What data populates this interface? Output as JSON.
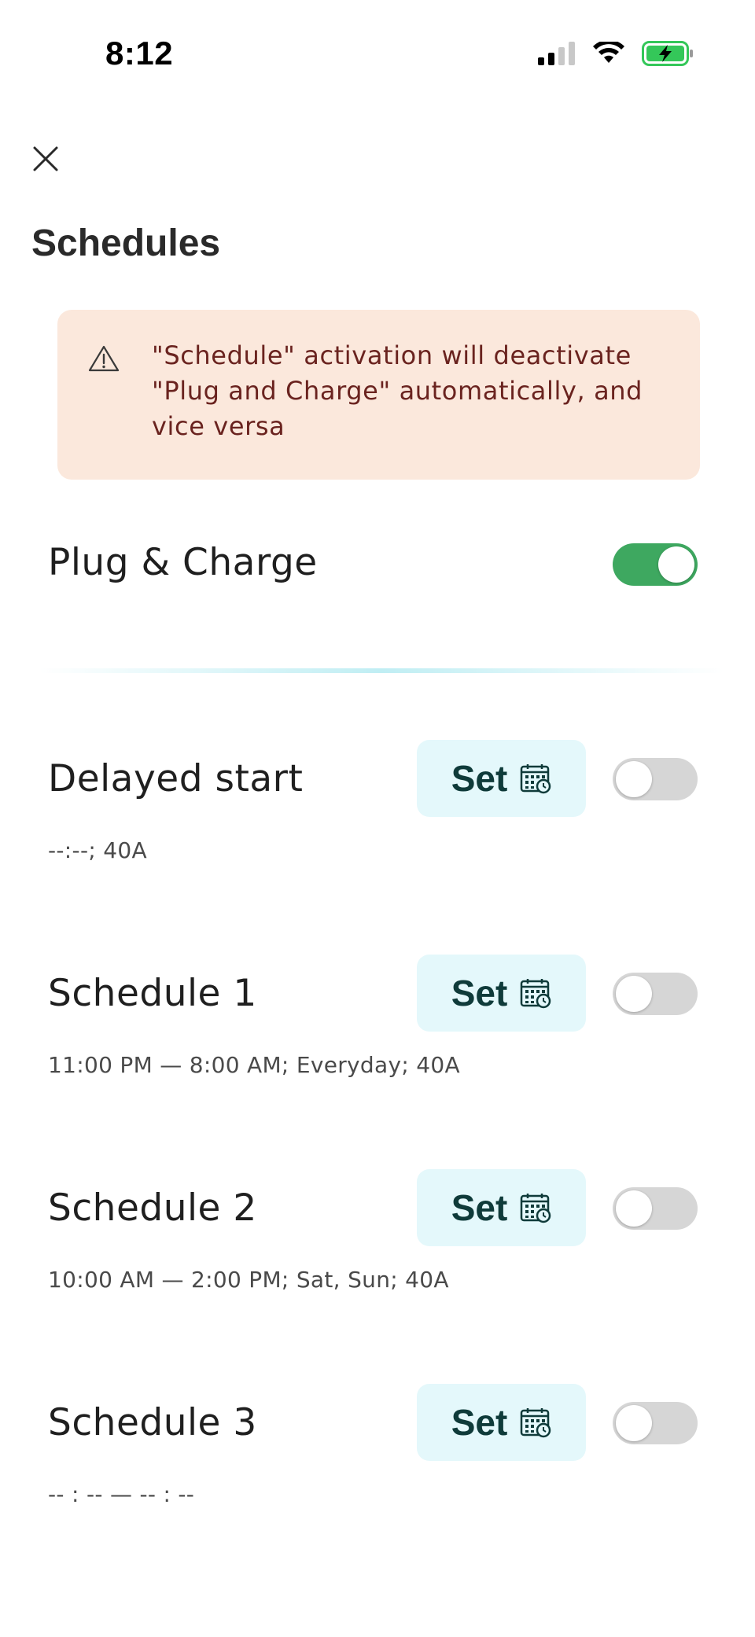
{
  "status_bar": {
    "time": "8:12"
  },
  "header": {
    "close_icon": "close-icon",
    "title": "Schedules"
  },
  "warning": {
    "icon": "warning-triangle-icon",
    "text": "\"Schedule\" activation will deactivate \"Plug and Charge\" automatically, and vice versa"
  },
  "plug_and_charge": {
    "label": "Plug & Charge",
    "enabled": true
  },
  "schedules": [
    {
      "title": "Delayed start",
      "details": "--:--; 40A",
      "button_label": "Set",
      "enabled": false
    },
    {
      "title": "Schedule 1",
      "details": "11:00 PM — 8:00 AM; Everyday; 40A",
      "button_label": "Set",
      "enabled": false
    },
    {
      "title": "Schedule 2",
      "details": "10:00 AM — 2:00 PM; Sat, Sun; 40A",
      "button_label": "Set",
      "enabled": false
    },
    {
      "title": "Schedule 3",
      "details": "-- : -- — -- : --",
      "button_label": "Set",
      "enabled": false
    }
  ],
  "colors": {
    "toggle_on": "#3ea860",
    "toggle_off": "#d6d6d6",
    "warning_bg": "#fbe8dc",
    "warning_text": "#6a231f",
    "set_button_bg": "#e4f8fb"
  }
}
